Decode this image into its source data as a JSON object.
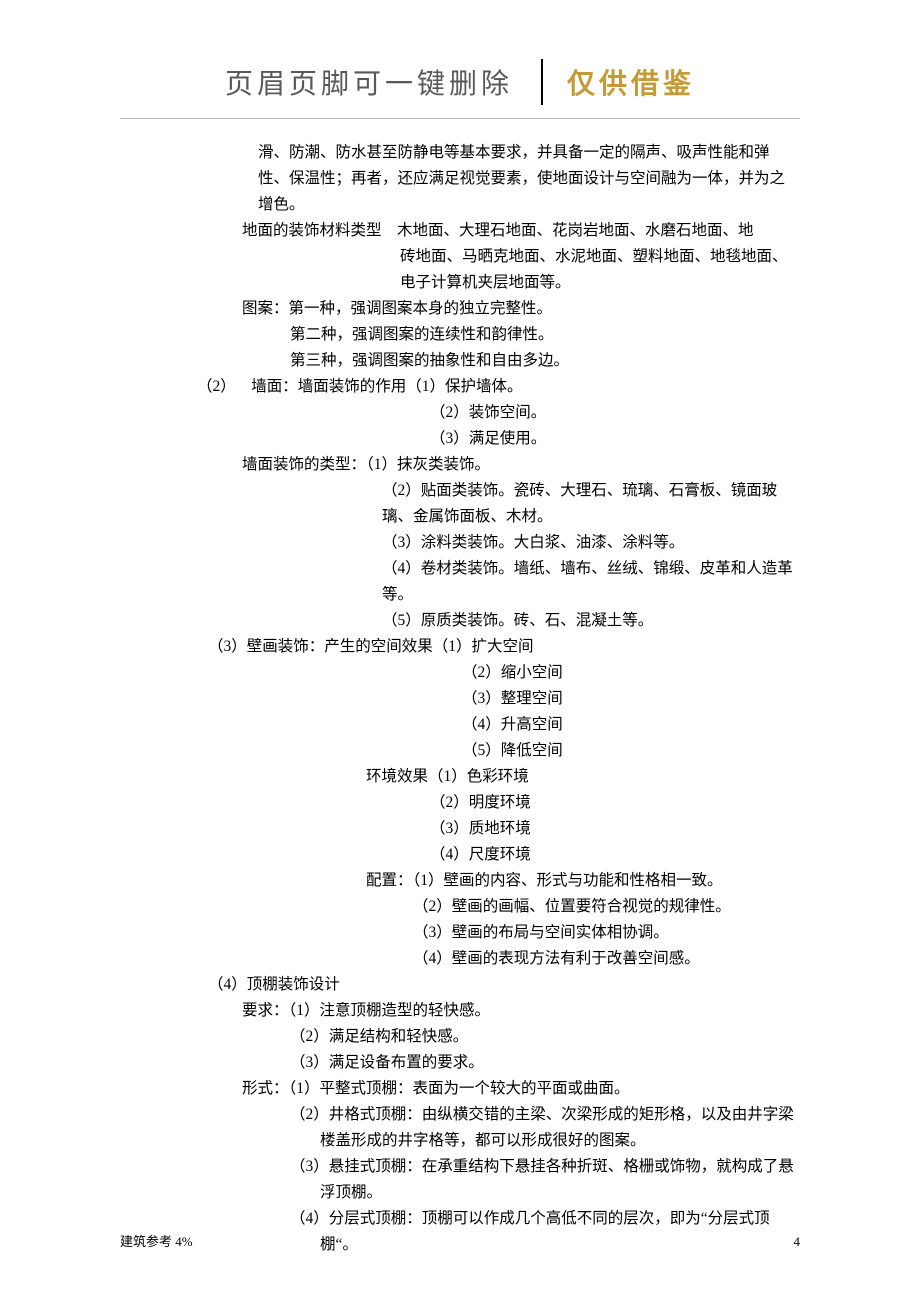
{
  "header": {
    "left": "页眉页脚可一键删除",
    "right": "仅供借鉴"
  },
  "body": {
    "p01": "滑、防潮、防水甚至防静电等基本要求，并具备一定的隔声、吸声性能和弹性、保温性；再者，还应满足视觉要素，使地面设计与空间融为一体，并为之增色。",
    "p02a": "地面的装饰材料类型 木地面、大理石地面、花岗岩地面、水磨石地面、地",
    "p02b": "砖地面、马晒克地面、水泥地面、塑料地面、地毯地面、电子计算机夹层地面等。",
    "p03": "图案：第一种，强调图案本身的独立完整性。",
    "p04": "第二种，强调图案的连续性和韵律性。",
    "p05": "第三种，强调图案的抽象性和自由多边。",
    "p06": "（2） 墙面：墙面装饰的作用（1）保护墙体。",
    "p07": "（2）装饰空间。",
    "p08": "（3）满足使用。",
    "p09": "墙面装饰的类型：（1）抹灰类装饰。",
    "p10": "（2）贴面类装饰。瓷砖、大理石、琉璃、石膏板、镜面玻璃、金属饰面板、木材。",
    "p11": "（3）涂料类装饰。大白浆、油漆、涂料等。",
    "p12": "（4）卷材类装饰。墙纸、墙布、丝绒、锦缎、皮革和人造革等。",
    "p13": "（5）原质类装饰。砖、石、混凝土等。",
    "p14": "（3）壁画装饰：产生的空间效果（1）扩大空间",
    "p15": "（2）缩小空间",
    "p16": "（3）整理空间",
    "p17": "（4）升高空间",
    "p18": "（5）降低空间",
    "p19": "环境效果（1）色彩环境",
    "p20": "（2）明度环境",
    "p21": "（3）质地环境",
    "p22": "（4）尺度环境",
    "p23": "配置：（1）壁画的内容、形式与功能和性格相一致。",
    "p24": "（2）壁画的画幅、位置要符合视觉的规律性。",
    "p25": "（3）壁画的布局与空间实体相协调。",
    "p26": "（4）壁画的表现方法有利于改善空间感。",
    "p27": "（4）顶棚装饰设计",
    "p28": "要求：（1）注意顶棚造型的轻快感。",
    "p29": "（2）满足结构和轻快感。",
    "p30": "（3）满足设备布置的要求。",
    "p31": "形式：（1）平整式顶棚：表面为一个较大的平面或曲面。",
    "p32": "（2）井格式顶棚：由纵横交错的主梁、次梁形成的矩形格，以及由井字梁楼盖形成的井字格等，都可以形成很好的图案。",
    "p33": "（3）悬挂式顶棚：在承重结构下悬挂各种折斑、格栅或饰物，就构成了悬浮顶棚。",
    "p34": "（4）分层式顶棚：顶棚可以作成几个高低不同的层次，即为“分层式顶棚“。"
  },
  "footer": {
    "left": "建筑参考 4%",
    "right": "4"
  }
}
